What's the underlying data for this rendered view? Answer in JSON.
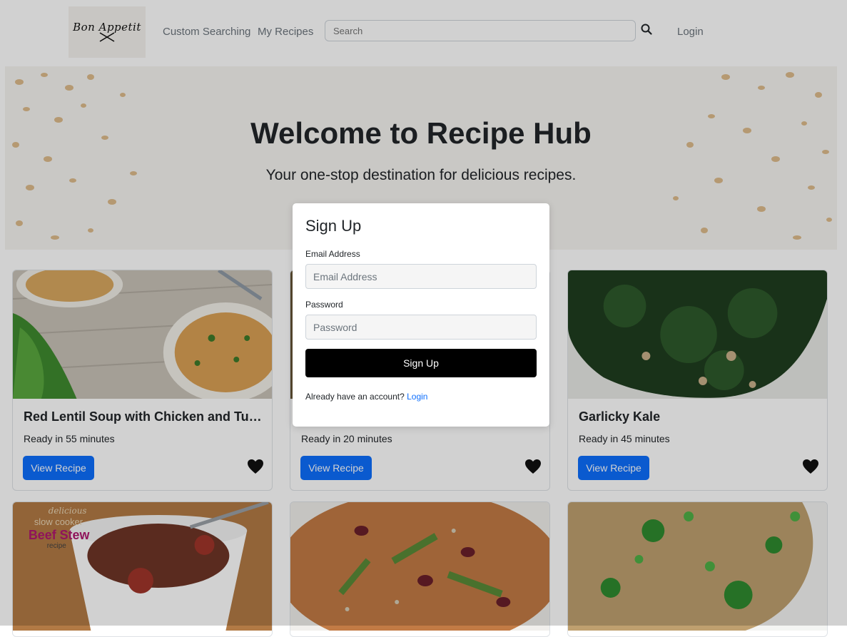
{
  "navbar": {
    "logo_text": "Bon Appetit",
    "links": [
      "Custom Searching",
      "My Recipes"
    ],
    "search_placeholder": "Search",
    "login_label": "Login"
  },
  "hero": {
    "title": "Welcome to Recipe Hub",
    "subtitle": "Your one-stop destination for delicious recipes."
  },
  "cards": [
    {
      "title": "Red Lentil Soup with Chicken and Turnips",
      "time": "Ready in 55 minutes",
      "button": "View Recipe"
    },
    {
      "title": "",
      "time": "Ready in 20 minutes",
      "button": "View Recipe"
    },
    {
      "title": "Garlicky Kale",
      "time": "Ready in 45 minutes",
      "button": "View Recipe"
    },
    {
      "image_text": [
        "delicious",
        "slow cooker",
        "Beef Stew",
        "recipe"
      ]
    }
  ],
  "modal": {
    "title": "Sign Up",
    "email_label": "Email Address",
    "email_placeholder": "Email Address",
    "password_label": "Password",
    "password_placeholder": "Password",
    "submit_label": "Sign Up",
    "already_text": "Already have an account?",
    "login_link": "Login"
  },
  "colors": {
    "primary": "#0d6efd",
    "submit": "#000000",
    "backdrop": "rgba(0,0,0,0.18)"
  }
}
